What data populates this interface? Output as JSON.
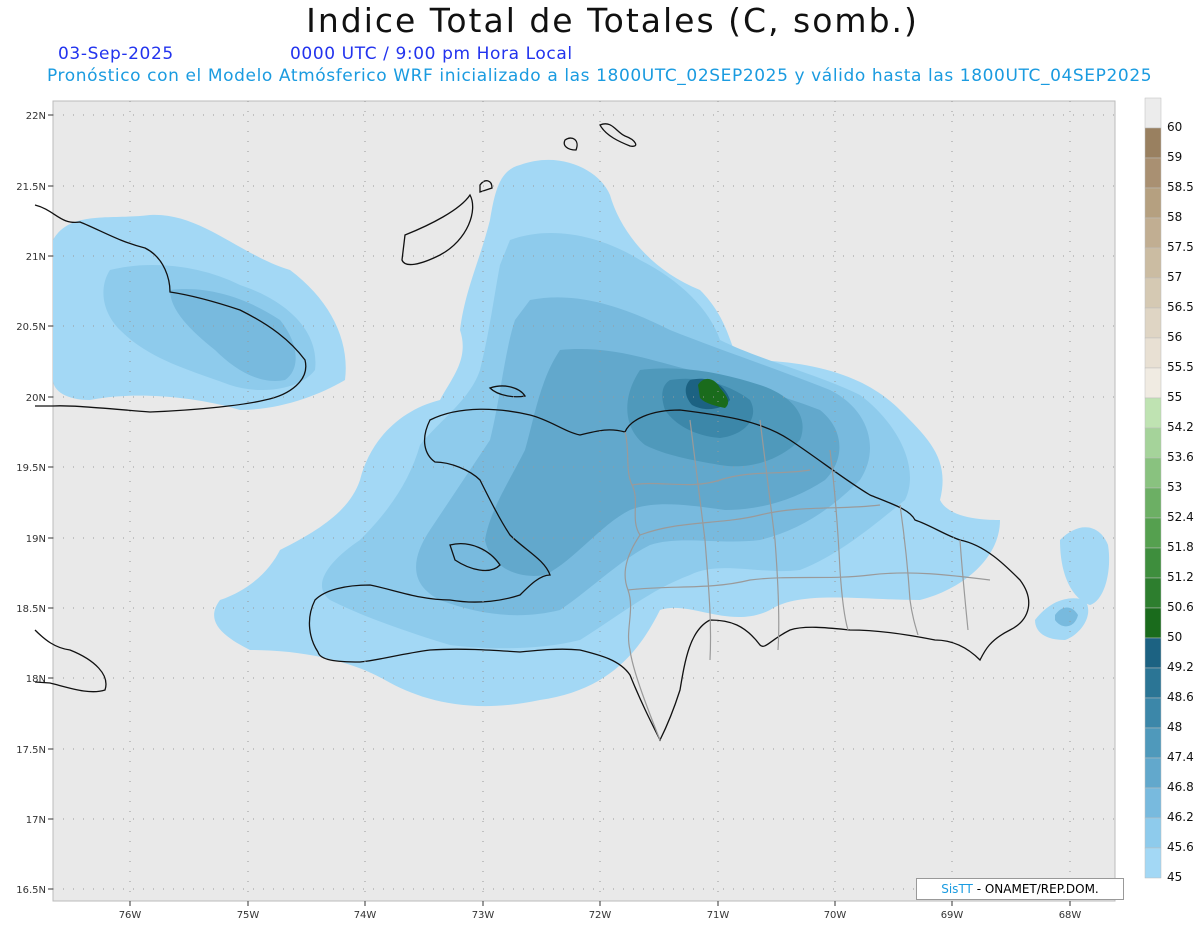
{
  "header": {
    "title": "Indice Total de Totales (C, somb.)",
    "date": "03-Sep-2025",
    "time": "0000 UTC / 9:00 pm Hora Local",
    "description": "Pronóstico con el Modelo Atmósferico WRF inicializado a las 1800UTC_02SEP2025 y válido hasta las  1800UTC_04SEP2025"
  },
  "map": {
    "lat_labels": [
      "22N",
      "21.5N",
      "21N",
      "20.5N",
      "20N",
      "19.5N",
      "19N",
      "18.5N",
      "18N",
      "17.5N",
      "17N",
      "16.5N"
    ],
    "lon_labels": [
      "76W",
      "75W",
      "74W",
      "73W",
      "72W",
      "71W",
      "70W",
      "69W",
      "68W"
    ]
  },
  "colorbar": {
    "labels": [
      "60",
      "59",
      "58.5",
      "58",
      "57.5",
      "57",
      "56.5",
      "56",
      "55.5",
      "55",
      "54.2",
      "53.6",
      "53",
      "52.4",
      "51.8",
      "51.2",
      "50.6",
      "50",
      "49.2",
      "48.6",
      "48",
      "47.4",
      "46.8",
      "46.2",
      "45.6",
      "45"
    ],
    "colors": [
      "#ececec",
      "#998060",
      "#a99072",
      "#b5a080",
      "#c1ae92",
      "#cbbca2",
      "#d5c9b3",
      "#dfd5c4",
      "#e8e0d3",
      "#f0ebe2",
      "#bfe3b2",
      "#a5d39a",
      "#89c27f",
      "#6caf64",
      "#55a04f",
      "#3e8e3d",
      "#2d7e2e",
      "#1a6b1c",
      "#1c6282",
      "#2b7595",
      "#3c87a9",
      "#4f99bb",
      "#62a8cc",
      "#78bade",
      "#8ecbec",
      "#a3d8f5"
    ]
  },
  "colors": {
    "ocean": "#e9e9e9",
    "land_background": "#f2f2f2",
    "coast": "#111111",
    "borders": "#9a9a9a",
    "contour_light": "#a3d8f5",
    "contour_dark": "#1c6282",
    "max_green": "#1a6b1c"
  },
  "credit": {
    "logo": "SisTT",
    "text": " - ONAMET/REP.DOM."
  }
}
